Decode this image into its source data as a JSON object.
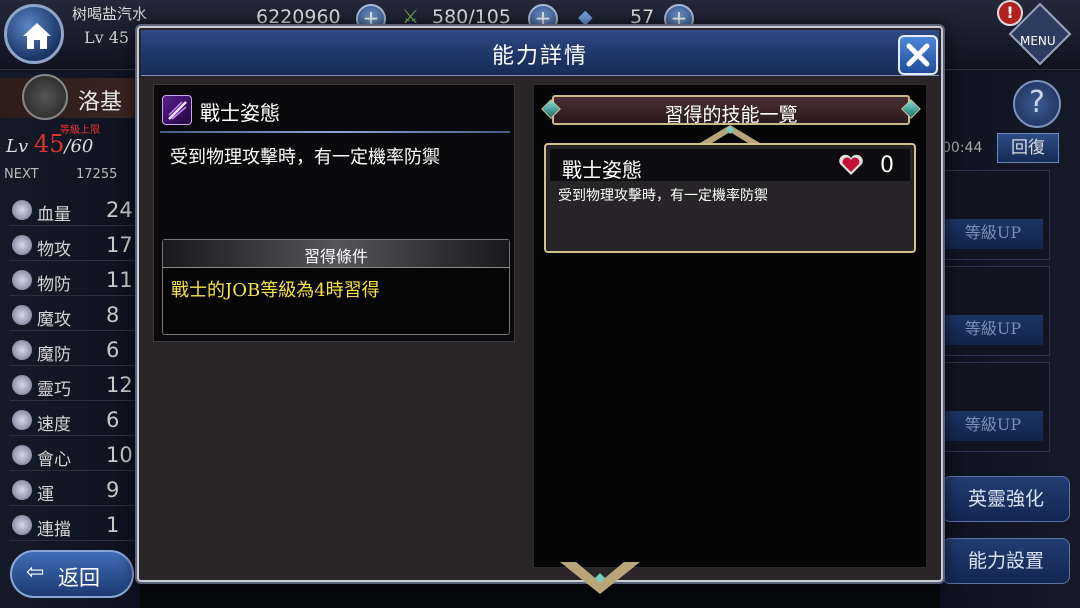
{
  "player": {
    "name": "树喝盐汽水",
    "level": "Lv 45"
  },
  "resources": {
    "gold": "6220960",
    "stamina": "580/105",
    "gems": "57"
  },
  "menu_label": "MENU",
  "character": {
    "name": "洛基",
    "level_current": "45",
    "level_max": "/60",
    "level_cap_note": "等級上限",
    "next_label": "NEXT",
    "next_value": "17255",
    "lv_label": "Lv"
  },
  "stats": [
    {
      "name": "血量",
      "value": "24"
    },
    {
      "name": "物攻",
      "value": "17"
    },
    {
      "name": "物防",
      "value": "11"
    },
    {
      "name": "魔攻",
      "value": "8"
    },
    {
      "name": "魔防",
      "value": "6"
    },
    {
      "name": "靈巧",
      "value": "12"
    },
    {
      "name": "速度",
      "value": "6"
    },
    {
      "name": "會心",
      "value": "10"
    },
    {
      "name": "運",
      "value": "9"
    },
    {
      "name": "連擋",
      "value": "1"
    }
  ],
  "back_label": "返回",
  "right_side": {
    "timer": "00:44",
    "recover_label": "回復",
    "level_up_label": "等級UP",
    "enhance_label": "英靈強化",
    "ability_setting_label": "能力設置"
  },
  "modal": {
    "title": "能力詳情",
    "skill": {
      "name": "戰士姿態",
      "description": "受到物理攻擊時，有一定機率防禦"
    },
    "condition": {
      "header": "習得條件",
      "text": "戰士的JOB等級為4時習得"
    },
    "learned_list": {
      "header": "習得的技能一覽",
      "items": [
        {
          "name": "戰士姿態",
          "count": "0",
          "description": "受到物理攻擊時，有一定機率防禦"
        }
      ]
    }
  },
  "colors": {
    "header_blue": "#1f3668",
    "condition_text": "#f4e24a",
    "card_border": "#cfc08c",
    "modal_bg": "#2a2628"
  }
}
